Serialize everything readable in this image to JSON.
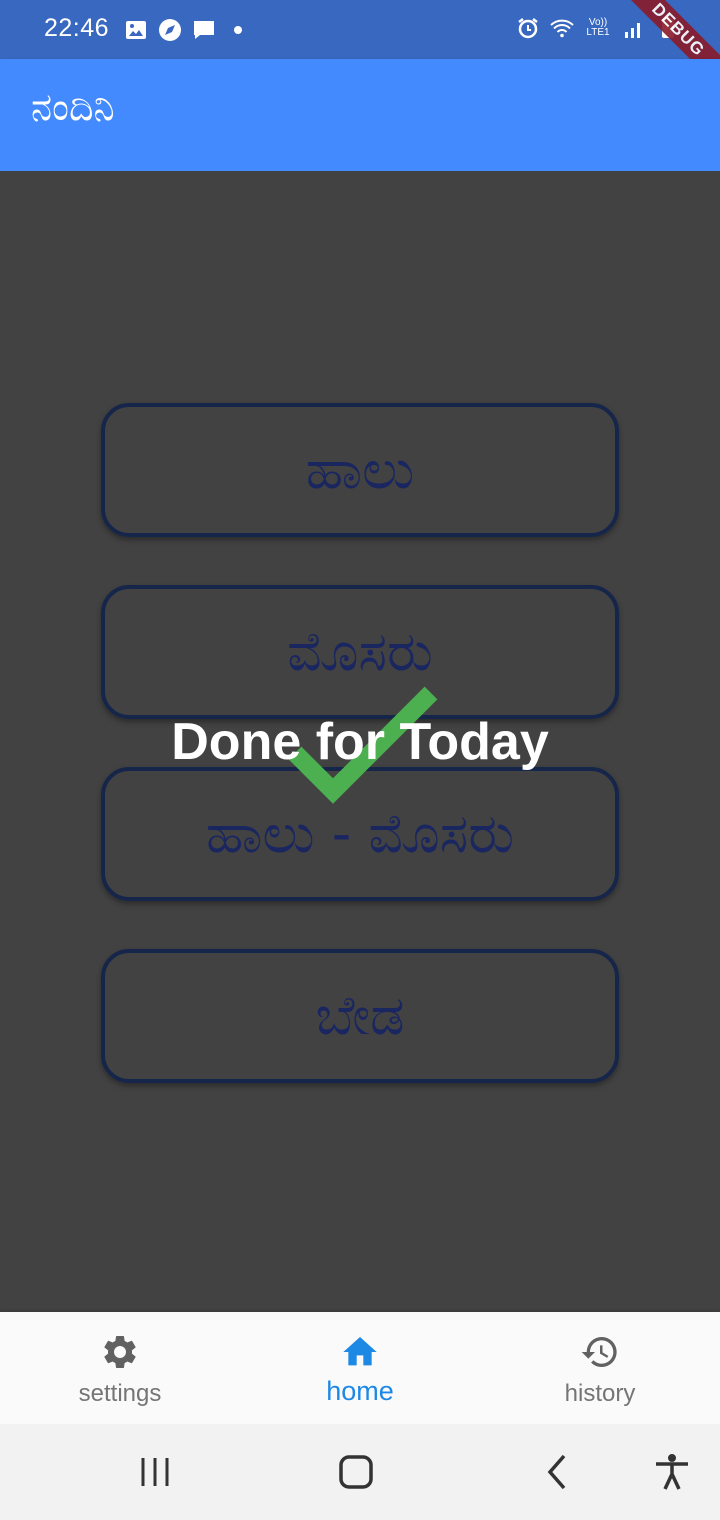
{
  "status_bar": {
    "time": "22:46",
    "network_label": "Vo)) LTE1",
    "debug_label": "DEBUG",
    "left_icons": [
      "gallery-icon",
      "compass-icon",
      "chat-icon",
      "dot-icon"
    ],
    "right_icons": [
      "alarm-icon",
      "wifi-icon",
      "signal-icon",
      "battery-icon"
    ]
  },
  "app_bar": {
    "title": "ನಂದಿನಿ"
  },
  "options": [
    {
      "label": "ಹಾಲು"
    },
    {
      "label": "ಮೊಸರು"
    },
    {
      "label": "ಹಾಲು - ಮೊಸರು"
    },
    {
      "label": "ಬೇಡ"
    }
  ],
  "overlay": {
    "message": "Done for Today",
    "check_color": "#4caf50"
  },
  "bottom_nav": {
    "items": [
      {
        "label": "settings",
        "icon": "gear-icon",
        "active": false
      },
      {
        "label": "home",
        "icon": "home-icon",
        "active": true
      },
      {
        "label": "history",
        "icon": "history-icon",
        "active": false
      }
    ],
    "active_color": "#1e88e5",
    "inactive_color": "#757575"
  },
  "system_nav": {
    "icons": [
      "recents-icon",
      "home-outline-icon",
      "back-icon",
      "accessibility-icon"
    ]
  },
  "colors": {
    "app_bar": "#448aff",
    "status_bar": "#3868c0",
    "background": "#424242",
    "button_border": "#16254a",
    "button_text": "#1a2660"
  }
}
